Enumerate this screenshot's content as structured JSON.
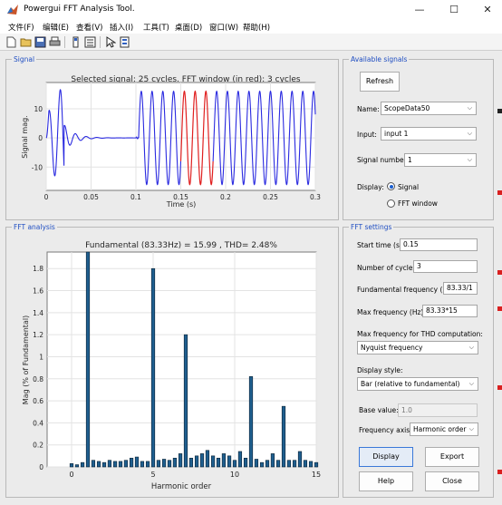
{
  "window": {
    "title": "Powergui FFT Analysis Tool.",
    "minimize": "—",
    "maximize": "☐",
    "close": "✕"
  },
  "menu": [
    "文件(F)",
    "编辑(E)",
    "查看(V)",
    "插入(I)",
    "工具(T)",
    "桌面(D)",
    "窗口(W)",
    "帮助(H)"
  ],
  "toolbar": [
    "new-icon",
    "open-icon",
    "save-icon",
    "print-icon",
    "toggle-colorbar-icon",
    "insert-legend-icon",
    "pointer-icon",
    "property-inspector-icon"
  ],
  "signal_panel": {
    "title": "Signal",
    "plot_title": "Selected signal: 25 cycles. FFT window (in red): 3 cycles",
    "xlabel": "Time (s)",
    "ylabel": "Signal mag.",
    "xticks": [
      "0",
      "0.05",
      "0.1",
      "0.15",
      "0.2",
      "0.25",
      "0.3"
    ],
    "yticks": [
      "10",
      "0",
      "-10"
    ]
  },
  "available_signals": {
    "title": "Available signals",
    "refresh": "Refresh",
    "name_label": "Name:",
    "name_value": "ScopeData50",
    "input_label": "Input:",
    "input_value": "input 1",
    "signal_number_label": "Signal number:",
    "signal_number_value": "1",
    "display_label": "Display:",
    "display_signal": "Signal",
    "display_fft_window": "FFT window",
    "selected_display": "Signal"
  },
  "fft_panel": {
    "title": "FFT analysis",
    "plot_title": "Fundamental (83.33Hz) = 15.99 , THD= 2.48%",
    "xlabel": "Harmonic order",
    "ylabel": "Mag (% of Fundamental)",
    "xticks": [
      "0",
      "5",
      "10",
      "15"
    ],
    "yticks": [
      "0",
      "0.2",
      "0.4",
      "0.6",
      "0.8",
      "1",
      "1.2",
      "1.4",
      "1.6",
      "1.8"
    ]
  },
  "fft_settings": {
    "title": "FFT settings",
    "start_time_label": "Start time (s):",
    "start_time_value": "0.15",
    "num_cycles_label": "Number of cycles:",
    "num_cycles_value": "3",
    "fund_freq_label": "Fundamental frequency (Hz):",
    "fund_freq_value": "83.33/1",
    "max_freq_label": "Max frequency (Hz):",
    "max_freq_value": "83.33*15",
    "max_thd_label": "Max frequency for THD computation:",
    "max_thd_value": "Nyquist frequency",
    "display_style_label": "Display style:",
    "display_style_value": "Bar (relative to fundamental)",
    "base_value_label": "Base value:",
    "base_value_value": "1.0",
    "freq_axis_label": "Frequency axis:",
    "freq_axis_value": "Harmonic order",
    "display_btn": "Display",
    "export_btn": "Export",
    "help_btn": "Help",
    "close_btn": "Close"
  },
  "colors": {
    "accent": "#1f4ec2",
    "signal_line": "#2a2ae0",
    "fft_window_line": "#e02020",
    "bar_fill": "#1f5f8f"
  },
  "chart_data": [
    {
      "type": "line",
      "title": "Selected signal: 25 cycles. FFT window (in red): 3 cycles",
      "xlabel": "Time (s)",
      "ylabel": "Signal mag.",
      "xlim": [
        0,
        0.3
      ],
      "ylim": [
        -18,
        19
      ],
      "grid": true,
      "series": [],
      "description_values": {
        "steady_amplitude": 16,
        "frequency_hz": 83.33,
        "fft_window_s": [
          0.15,
          0.186
        ]
      }
    },
    {
      "type": "bar",
      "title": "Fundamental (83.33Hz) = 15.99 , THD= 2.48%",
      "xlabel": "Harmonic order",
      "ylabel": "Mag (% of Fundamental)",
      "xlim": [
        -1.5,
        15
      ],
      "ylim": [
        0,
        1.95
      ],
      "grid": true,
      "x": [
        0,
        0.33,
        0.67,
        1,
        1.33,
        1.67,
        2,
        2.33,
        2.67,
        3,
        3.33,
        3.67,
        4,
        4.33,
        4.67,
        5,
        5.33,
        5.67,
        6,
        6.33,
        6.67,
        7,
        7.33,
        7.67,
        8,
        8.33,
        8.67,
        9,
        9.33,
        9.67,
        10,
        10.33,
        10.67,
        11,
        11.33,
        11.67,
        12,
        12.33,
        12.67,
        13,
        13.33,
        13.67,
        14,
        14.33,
        14.67,
        15
      ],
      "values": [
        0.03,
        0.02,
        0.04,
        1.95,
        0.06,
        0.05,
        0.04,
        0.06,
        0.05,
        0.05,
        0.06,
        0.08,
        0.09,
        0.05,
        0.05,
        1.8,
        0.06,
        0.07,
        0.06,
        0.08,
        0.12,
        1.2,
        0.08,
        0.1,
        0.12,
        0.15,
        0.1,
        0.08,
        0.12,
        0.1,
        0.06,
        0.14,
        0.08,
        0.82,
        0.07,
        0.04,
        0.06,
        0.12,
        0.06,
        0.55,
        0.06,
        0.06,
        0.14,
        0.06,
        0.05,
        0.04
      ]
    }
  ]
}
